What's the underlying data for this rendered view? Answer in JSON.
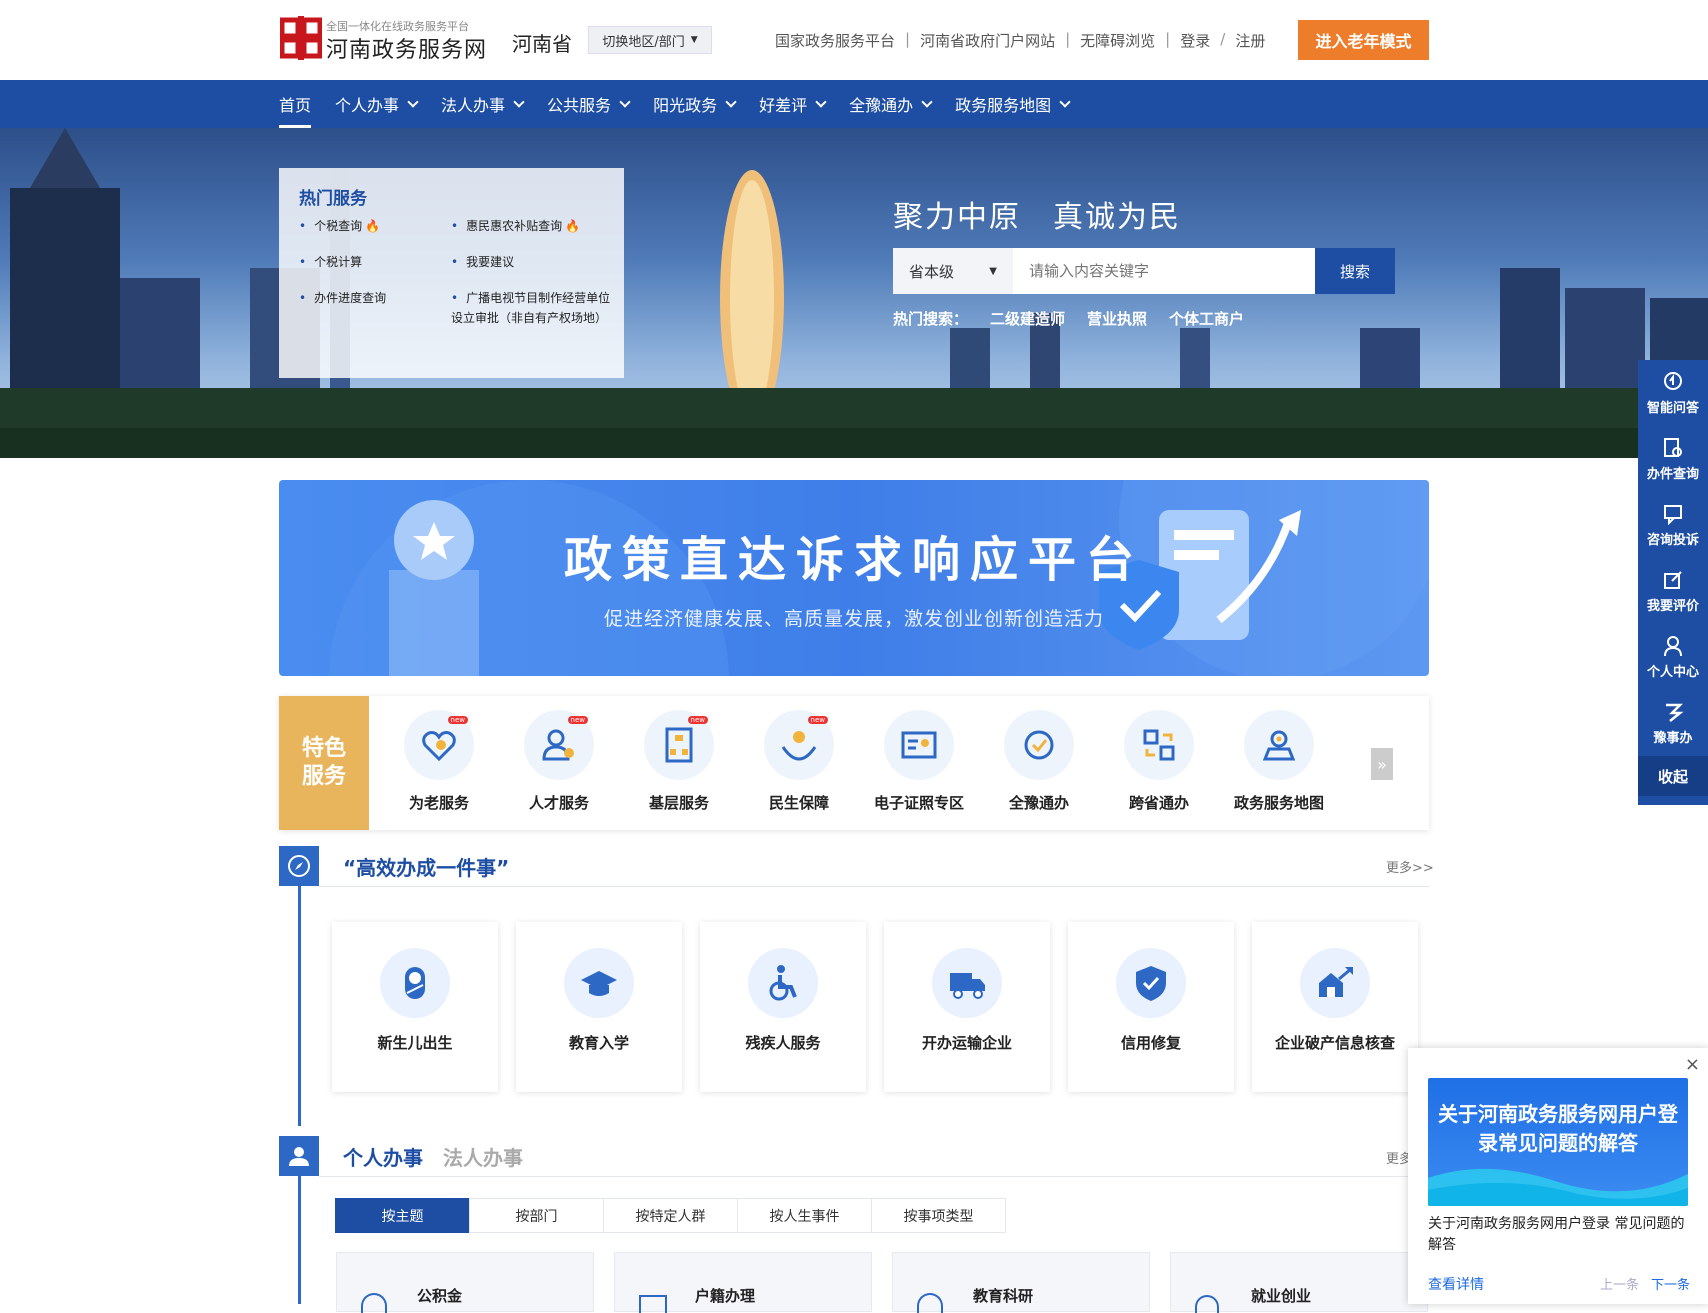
{
  "header": {
    "logo_sub": "全国一体化在线政务服务平台",
    "logo_name": "河南政务服务网",
    "province": "河南省",
    "region_switch": "切换地区/部门",
    "links": [
      "国家政务服务平台",
      "河南省政府门户网站",
      "无障碍浏览",
      "登录",
      "注册"
    ],
    "link_seps": [
      "|",
      "|",
      "|",
      "/"
    ],
    "elder_mode": "进入老年模式"
  },
  "nav": {
    "items": [
      "首页",
      "个人办事",
      "法人办事",
      "公共服务",
      "阳光政务",
      "好差评",
      "全豫通办",
      "政务服务地图"
    ]
  },
  "hot_services": {
    "title": "热门服务",
    "items": [
      "个税查询",
      "惠民惠农补贴查询",
      "个税计算",
      "我要建议",
      "办件进度查询",
      "广播电视节目制作经营单位设立审批（非自有产权场地）"
    ]
  },
  "hero": {
    "slogan": "聚力中原　真诚为民",
    "scope": "省本级",
    "search_placeholder": "请输入内容关键字",
    "search_button": "搜索",
    "hot_search_label": "热门搜索：",
    "hot_search": [
      "二级建造师",
      "营业执照",
      "个体工商户"
    ]
  },
  "banner": {
    "title": "政策直达诉求响应平台",
    "subtitle": "促进经济健康发展、高质量发展，激发创业创新创造活力"
  },
  "featured": {
    "label": "特色服务",
    "items": [
      "为老服务",
      "人才服务",
      "基层服务",
      "民生保障",
      "电子证照专区",
      "全豫通办",
      "跨省通办",
      "政务服务地图"
    ],
    "new_badge": "new"
  },
  "efficient": {
    "title": "“高效办成一件事”",
    "more": "更多>>",
    "cards": [
      "新生儿出生",
      "教育入学",
      "残疾人服务",
      "开办运输企业",
      "信用修复",
      "企业破产信息核查"
    ]
  },
  "affairs": {
    "tab_personal": "个人办事",
    "tab_legal": "法人办事",
    "more": "更多",
    "subtabs": [
      "按主题",
      "按部门",
      "按特定人群",
      "按人生事件",
      "按事项类型"
    ],
    "topics": [
      "公积金",
      "户籍办理",
      "教育科研",
      "就业创业"
    ]
  },
  "sidebar": {
    "items": [
      "智能问答",
      "办件查询",
      "咨询投诉",
      "我要评价",
      "个人中心",
      "豫事办"
    ],
    "collapse": "收起"
  },
  "popup": {
    "close": "×",
    "image_text": "关于河南政务服务网用户登录常见问题的解答",
    "text": "关于河南政务服务网用户登录 常见问题的解答",
    "link": "查看详情",
    "prev": "上一条",
    "next": "下一条"
  },
  "colors": {
    "primary": "#1d4ea3",
    "accent_orange": "#ee7d2b",
    "featured_gold": "#e8b55c"
  }
}
